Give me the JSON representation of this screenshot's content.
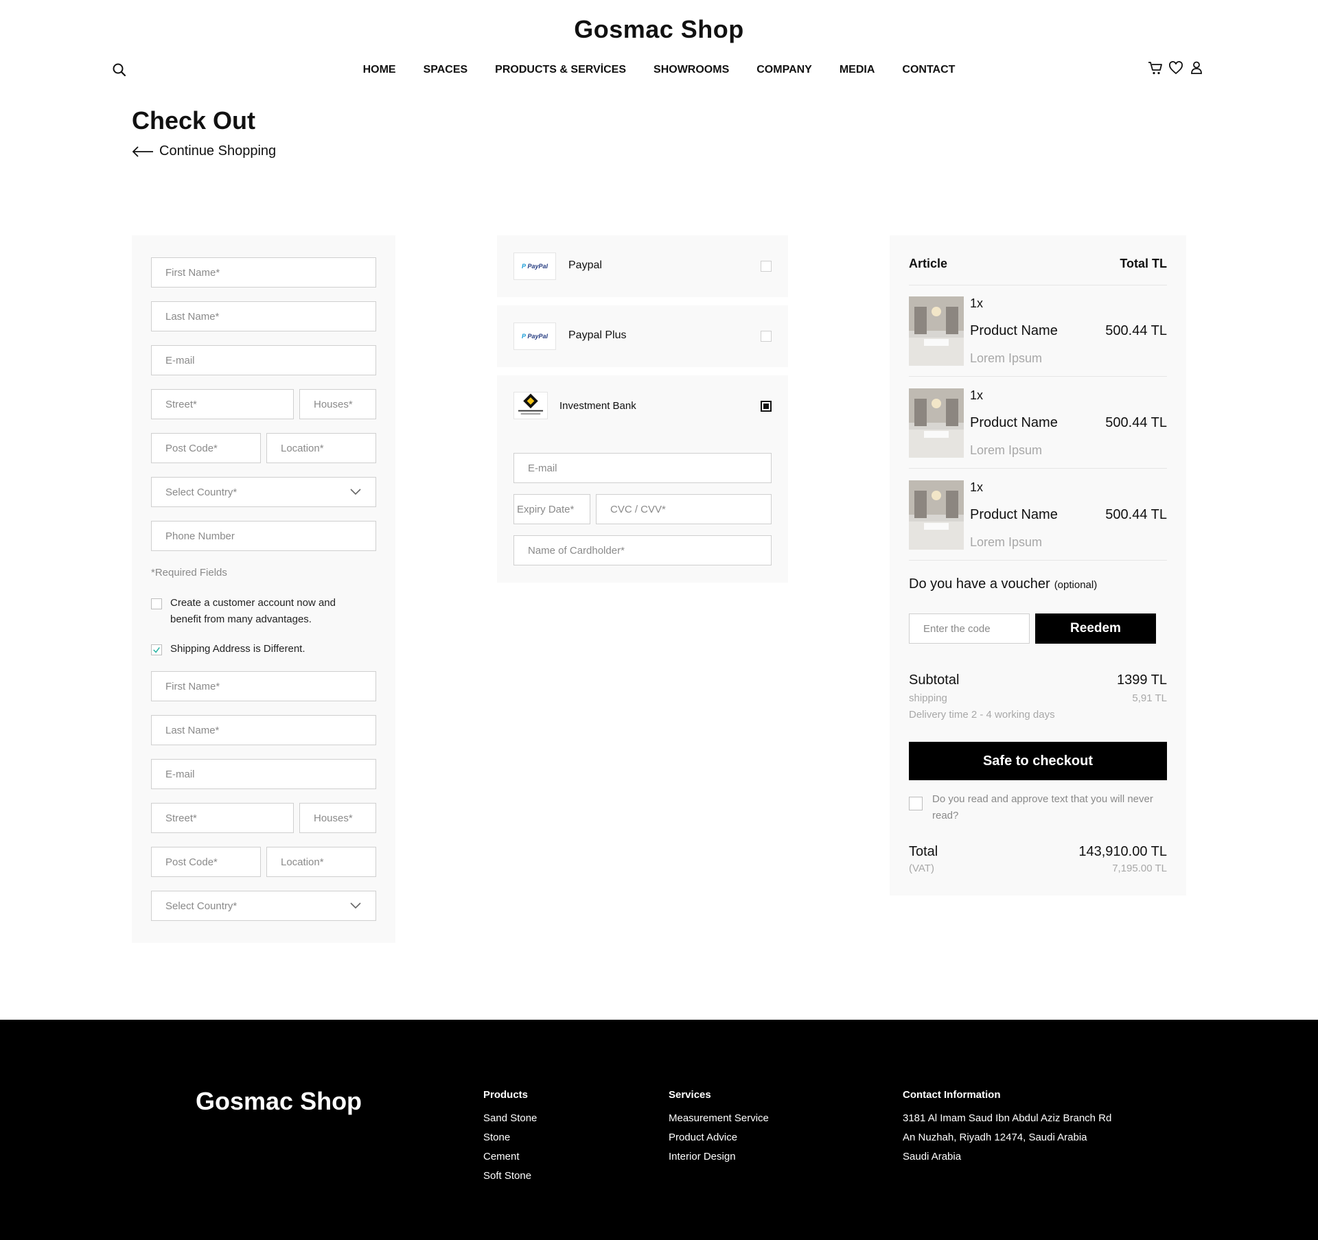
{
  "header": {
    "brand": "Gosmac Shop",
    "nav": [
      "HOME",
      "SPACES",
      "PRODUCTS & SERVİCES",
      "SHOWROOMS",
      "COMPANY",
      "MEDIA",
      "CONTACT"
    ]
  },
  "page": {
    "title": "Check Out",
    "continue_label": "Continue Shopping"
  },
  "billing": {
    "first_name": "First Name*",
    "last_name": "Last Name*",
    "email": "E-mail",
    "street": "Street*",
    "houses": "Houses*",
    "post_code": "Post Code*",
    "location": "Location*",
    "country": "Select Country*",
    "phone": "Phone Number",
    "required_note": "*Required Fields",
    "create_account": "Create a customer account now and benefit from many advantages.",
    "shipping_different": "Shipping Address is Different."
  },
  "shipping": {
    "first_name": "First Name*",
    "last_name": "Last Name*",
    "email": "E-mail",
    "street": "Street*",
    "houses": "Houses*",
    "post_code": "Post Code*",
    "location": "Location*",
    "country": "Select Country*"
  },
  "payment": {
    "methods": [
      {
        "name": "Paypal",
        "logo": "PayPal",
        "selected": false
      },
      {
        "name": "Paypal Plus",
        "logo": "PayPal",
        "selected": false
      },
      {
        "name": "Investment Bank",
        "logo": "bank-logo",
        "selected": true
      }
    ],
    "card": {
      "email": "E-mail",
      "expiry": "Expiry Date*",
      "cvc": "CVC / CVV*",
      "cardholder": "Name of Cardholder*"
    }
  },
  "summary": {
    "article_label": "Article",
    "total_label": "Total TL",
    "items": [
      {
        "qty": "1x",
        "name": "Product Name",
        "price": "500.44 TL",
        "sub": "Lorem Ipsum"
      },
      {
        "qty": "1x",
        "name": "Product Name",
        "price": "500.44 TL",
        "sub": "Lorem Ipsum"
      },
      {
        "qty": "1x",
        "name": "Product Name",
        "price": "500.44 TL",
        "sub": "Lorem Ipsum"
      }
    ],
    "voucher_question": "Do you have a voucher",
    "voucher_optional": "(optional)",
    "voucher_placeholder": "Enter the code",
    "redeem_label": "Reedem",
    "subtotal_label": "Subtotal",
    "subtotal_value": "1399 TL",
    "shipping_label": "shipping",
    "shipping_value": "5,91 TL",
    "delivery_note": "Delivery time 2 - 4 working days",
    "checkout_label": "Safe to checkout",
    "approve_text": "Do you read and approve text that you will never read?",
    "total_label_bottom": "Total",
    "total_value": "143,910.00 TL",
    "vat_label": "(VAT)",
    "vat_value": "7,195.00 TL"
  },
  "footer": {
    "brand": "Gosmac Shop",
    "products_title": "Products",
    "products": [
      "Sand Stone",
      "Stone",
      "Cement",
      "Soft Stone"
    ],
    "services_title": "Services",
    "services": [
      "Measurement Service",
      "Product Advice",
      "Interior Design"
    ],
    "contact_title": "Contact Information",
    "contact": [
      "3181 Al Imam Saud Ibn Abdul Aziz Branch Rd",
      "An Nuzhah, Riyadh 12474, Saudi Arabia",
      "Saudi Arabia"
    ]
  },
  "colors": {
    "accent": "#000000",
    "panel": "#f9f9f9",
    "check_teal": "#2bb5a4"
  }
}
